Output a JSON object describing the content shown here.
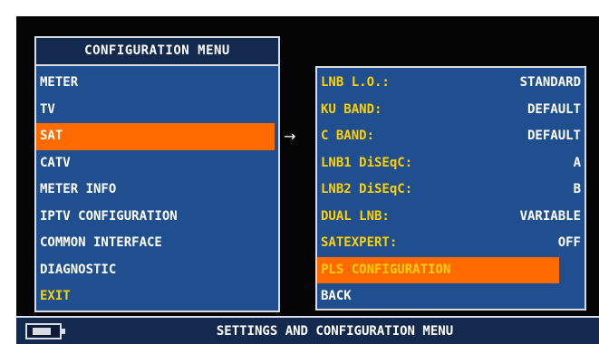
{
  "colors": {
    "panel_bg": "#1f4f8e",
    "title_bg": "#13294d",
    "highlight": "#ff6a00",
    "label_yellow": "#ffd000",
    "text_white": "#ffffff",
    "screen_bg": "#050505"
  },
  "config_menu": {
    "title": "CONFIGURATION MENU",
    "items": [
      {
        "label": "METER"
      },
      {
        "label": "TV"
      },
      {
        "label": "SAT"
      },
      {
        "label": "CATV"
      },
      {
        "label": "METER INFO"
      },
      {
        "label": "IPTV CONFIGURATION"
      },
      {
        "label": "COMMON INTERFACE"
      },
      {
        "label": "DIAGNOSTIC"
      },
      {
        "label": "EXIT"
      }
    ],
    "selected": "SAT"
  },
  "arrow_icon": "right-arrow-icon",
  "sat_settings": {
    "rows": [
      {
        "label": "LNB L.O.:",
        "value": "STANDARD"
      },
      {
        "label": "KU BAND:",
        "value": "DEFAULT"
      },
      {
        "label": "C BAND:",
        "value": "DEFAULT"
      },
      {
        "label": "LNB1 DiSEqC:",
        "value": "A"
      },
      {
        "label": "LNB2 DiSEqC:",
        "value": "B"
      },
      {
        "label": "DUAL LNB:",
        "value": "VARIABLE"
      },
      {
        "label": "SATEXPERT:",
        "value": "OFF"
      },
      {
        "label": "PLS CONFIGURATION",
        "value": ""
      },
      {
        "label": "BACK",
        "value": ""
      }
    ],
    "highlighted": "PLS CONFIGURATION"
  },
  "status_bar": {
    "icon": "battery-icon",
    "text": "SETTINGS AND CONFIGURATION MENU"
  }
}
